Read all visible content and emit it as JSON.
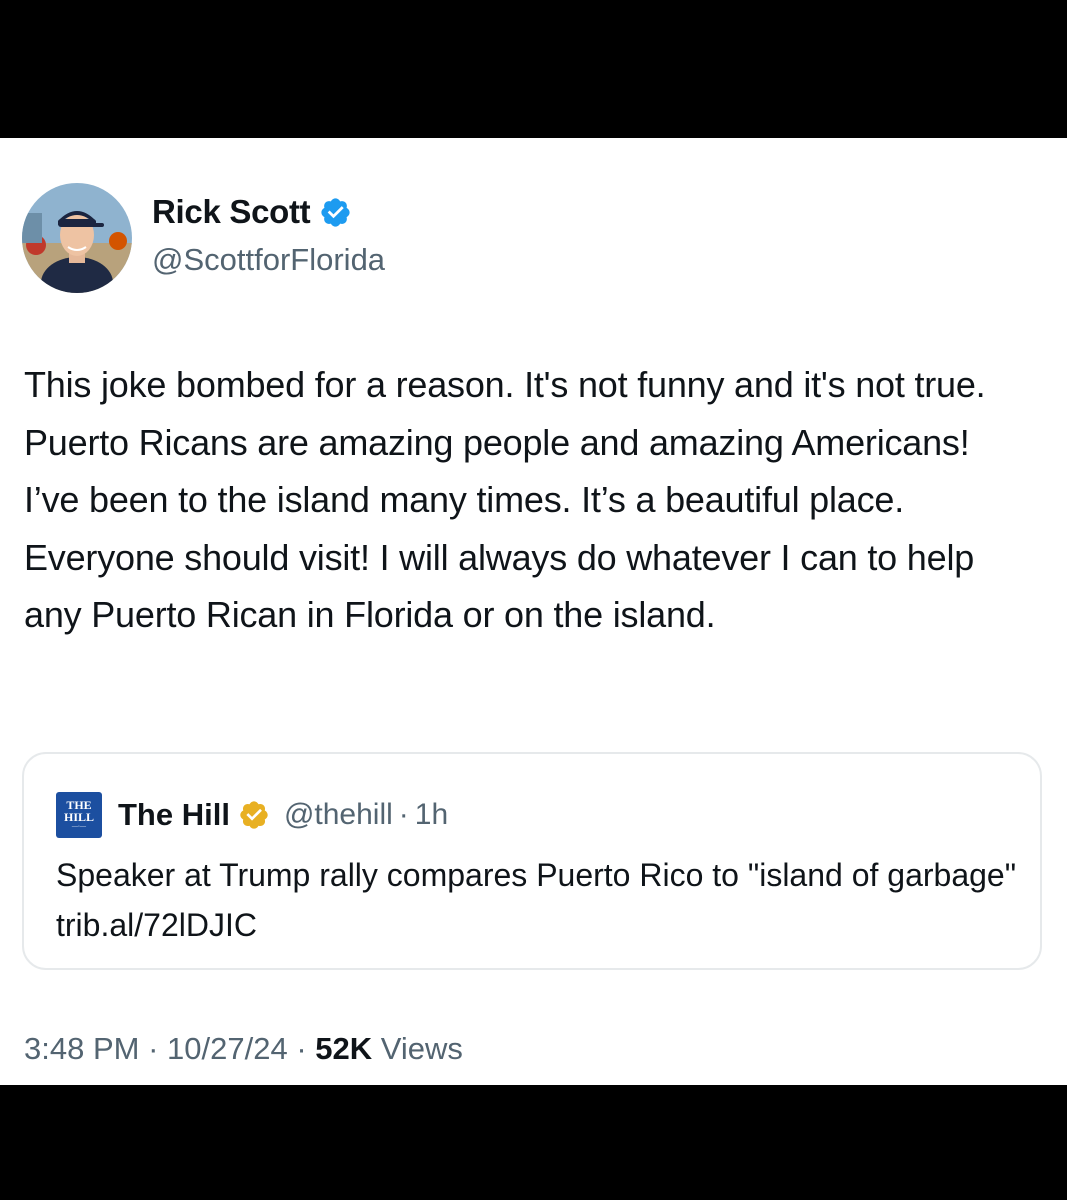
{
  "author": {
    "display_name": "Rick Scott",
    "handle": "@ScottforFlorida",
    "verified_color": "#1d9bf0"
  },
  "tweet": {
    "text": "This joke bombed for a reason. It's not funny and it's not true. Puerto Ricans are amazing people and amazing Americans! I’ve been to the island many times. It’s a beautiful place. Everyone should visit! I will always do whatever I can to help any Puerto Rican in Florida or on the island."
  },
  "quoted_tweet": {
    "logo_text_top": "THE",
    "logo_text_bottom": "HILL",
    "display_name": "The Hill",
    "handle": "@thehill",
    "separator": "·",
    "time": "1h",
    "verified_color": "#e8b023",
    "text": "Speaker at Trump rally compares Puerto Rico to \"island of garbage\" trib.al/72lDJIC"
  },
  "meta": {
    "time": "3:48 PM",
    "separator": "·",
    "date": "10/27/24",
    "views_count": "52K",
    "views_label": "Views"
  }
}
